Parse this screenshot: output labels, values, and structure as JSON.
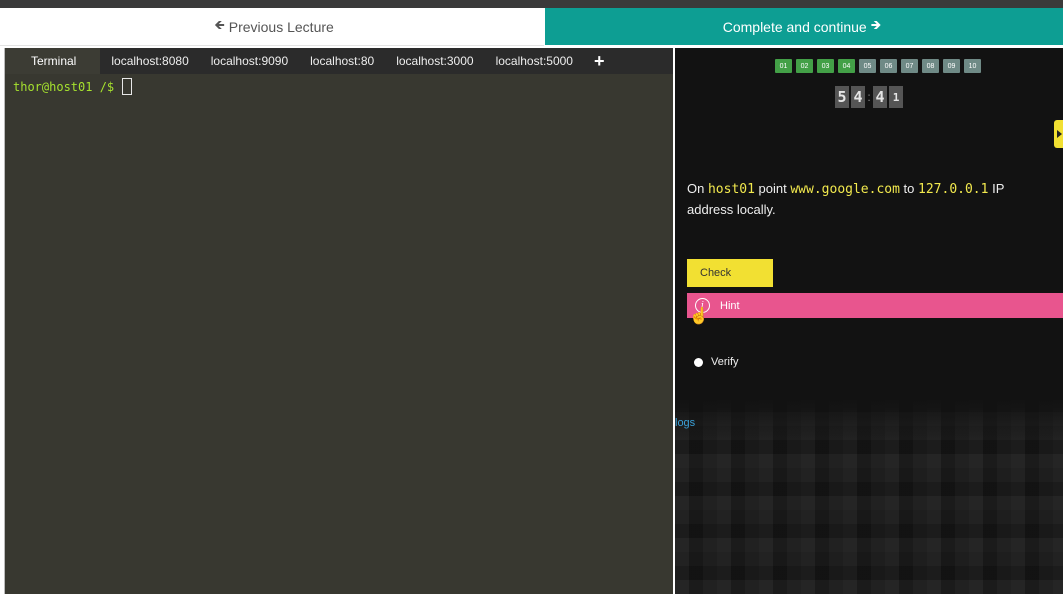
{
  "nav": {
    "prev_label": "Previous Lecture",
    "next_label": "Complete and continue",
    "prev_arrow_icon": "arrow-left-icon",
    "next_arrow_icon": "arrow-right-icon"
  },
  "terminal": {
    "tabs": [
      "Terminal",
      "localhost:8080",
      "localhost:9090",
      "localhost:80",
      "localhost:3000",
      "localhost:5000"
    ],
    "active_tab": "Terminal",
    "add_tab_label": "+",
    "prompt": "thor@host01 /$"
  },
  "quiz": {
    "questions": [
      "01",
      "02",
      "03",
      "04",
      "05",
      "06",
      "07",
      "08",
      "09",
      "10"
    ],
    "completed_count": 4,
    "timer": {
      "minutes": [
        "5",
        "4"
      ],
      "seconds": [
        "4",
        "1"
      ]
    },
    "question": {
      "p1": "On ",
      "host": "host01",
      "p2": " point ",
      "domain": "www.google.com",
      "p3": " to ",
      "ip": "127.0.0.1",
      "p4": " IP address locally."
    },
    "check_label": "Check",
    "hint_label": "Hint",
    "verify_label": "Verify",
    "logs_label": "logs"
  },
  "colors": {
    "accent_teal": "#0d9e93",
    "check_yellow": "#f2e032",
    "hint_pink": "#e8558e",
    "done_green": "#43a047"
  }
}
